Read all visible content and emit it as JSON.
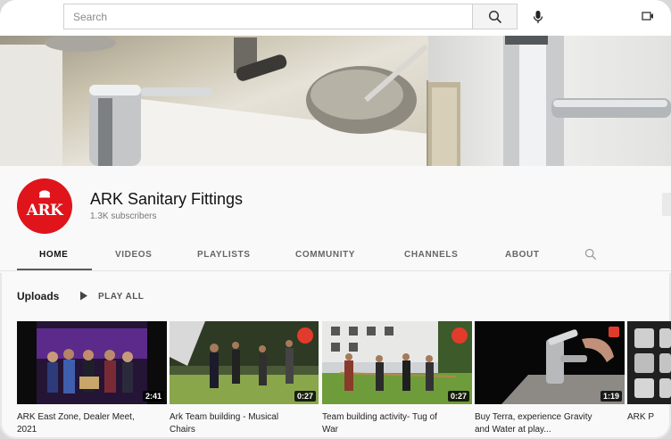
{
  "search": {
    "placeholder": "Search"
  },
  "channel": {
    "avatar_text": "ARK",
    "name": "ARK Sanitary Fittings",
    "subscribers": "1.3K subscribers"
  },
  "tabs": [
    {
      "label": "HOME",
      "active": true
    },
    {
      "label": "VIDEOS"
    },
    {
      "label": "PLAYLISTS"
    },
    {
      "label": "COMMUNITY"
    },
    {
      "label": "CHANNELS"
    },
    {
      "label": "ABOUT"
    }
  ],
  "uploads": {
    "label": "Uploads",
    "play_all": "PLAY ALL"
  },
  "videos": [
    {
      "title_line1": "ARK East Zone, Dealer Meet,",
      "title_line2": "2021",
      "duration": "2:41"
    },
    {
      "title_line1": "Ark Team building - Musical",
      "title_line2": "Chairs",
      "duration": "0:27"
    },
    {
      "title_line1": "Team building activity- Tug of",
      "title_line2": "War",
      "duration": "0:27"
    },
    {
      "title_line1": "Buy Terra, experience Gravity",
      "title_line2": "and Water at play...",
      "duration": "1:19"
    },
    {
      "title_line1": "ARK P",
      "title_line2": ""
    }
  ],
  "colors": {
    "brand_red": "#e0141b",
    "accent": "#0f0f0f"
  }
}
